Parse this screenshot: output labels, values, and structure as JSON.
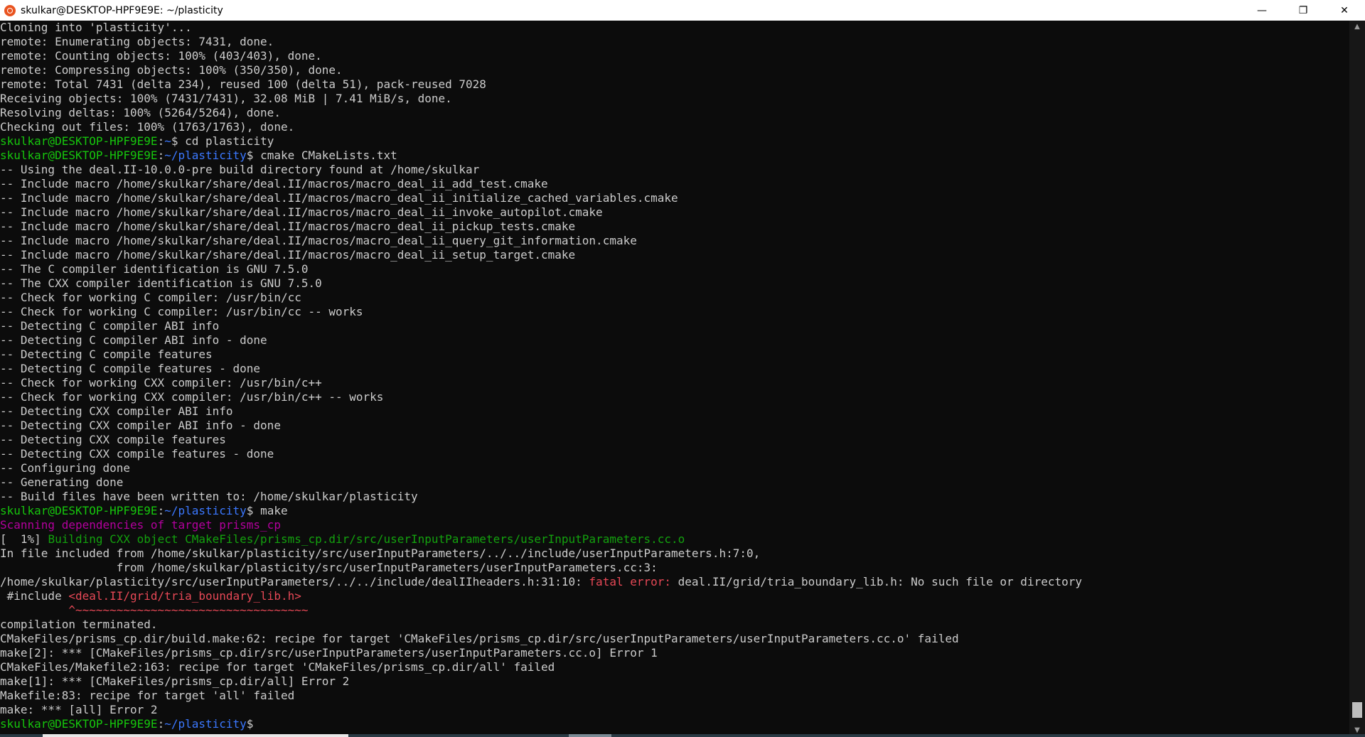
{
  "window": {
    "title": "skulkar@DESKTOP-HPF9E9E: ~/plasticity",
    "minimize_glyph": "—",
    "restore_glyph": "❐",
    "close_glyph": "✕",
    "icon": "ubuntu-icon"
  },
  "colors": {
    "background": "#0c0c0c",
    "text": "#cccccc",
    "prompt_user": "#16c60c",
    "prompt_path": "#3b78ff",
    "magenta": "#b4009e",
    "build_green": "#13a10e",
    "error_red": "#e74856"
  },
  "terminal": {
    "lines": [
      [
        {
          "t": "Cloning into 'plasticity'...",
          "c": "default"
        }
      ],
      [
        {
          "t": "remote: Enumerating objects: 7431, done.",
          "c": "default"
        }
      ],
      [
        {
          "t": "remote: Counting objects: 100% (403/403), done.",
          "c": "default"
        }
      ],
      [
        {
          "t": "remote: Compressing objects: 100% (350/350), done.",
          "c": "default"
        }
      ],
      [
        {
          "t": "remote: Total 7431 (delta 234), reused 100 (delta 51), pack-reused 7028",
          "c": "default"
        }
      ],
      [
        {
          "t": "Receiving objects: 100% (7431/7431), 32.08 MiB | 7.41 MiB/s, done.",
          "c": "default"
        }
      ],
      [
        {
          "t": "Resolving deltas: 100% (5264/5264), done.",
          "c": "default"
        }
      ],
      [
        {
          "t": "Checking out files: 100% (1763/1763), done.",
          "c": "default"
        }
      ],
      [
        {
          "t": "skulkar@DESKTOP-HPF9E9E",
          "c": "green"
        },
        {
          "t": ":",
          "c": "default"
        },
        {
          "t": "~",
          "c": "blue"
        },
        {
          "t": "$ cd plasticity",
          "c": "default"
        }
      ],
      [
        {
          "t": "skulkar@DESKTOP-HPF9E9E",
          "c": "green"
        },
        {
          "t": ":",
          "c": "default"
        },
        {
          "t": "~/plasticity",
          "c": "blue"
        },
        {
          "t": "$ cmake CMakeLists.txt",
          "c": "default"
        }
      ],
      [
        {
          "t": "-- Using the deal.II-10.0.0-pre build directory found at /home/skulkar",
          "c": "default"
        }
      ],
      [
        {
          "t": "-- Include macro /home/skulkar/share/deal.II/macros/macro_deal_ii_add_test.cmake",
          "c": "default"
        }
      ],
      [
        {
          "t": "-- Include macro /home/skulkar/share/deal.II/macros/macro_deal_ii_initialize_cached_variables.cmake",
          "c": "default"
        }
      ],
      [
        {
          "t": "-- Include macro /home/skulkar/share/deal.II/macros/macro_deal_ii_invoke_autopilot.cmake",
          "c": "default"
        }
      ],
      [
        {
          "t": "-- Include macro /home/skulkar/share/deal.II/macros/macro_deal_ii_pickup_tests.cmake",
          "c": "default"
        }
      ],
      [
        {
          "t": "-- Include macro /home/skulkar/share/deal.II/macros/macro_deal_ii_query_git_information.cmake",
          "c": "default"
        }
      ],
      [
        {
          "t": "-- Include macro /home/skulkar/share/deal.II/macros/macro_deal_ii_setup_target.cmake",
          "c": "default"
        }
      ],
      [
        {
          "t": "-- The C compiler identification is GNU 7.5.0",
          "c": "default"
        }
      ],
      [
        {
          "t": "-- The CXX compiler identification is GNU 7.5.0",
          "c": "default"
        }
      ],
      [
        {
          "t": "-- Check for working C compiler: /usr/bin/cc",
          "c": "default"
        }
      ],
      [
        {
          "t": "-- Check for working C compiler: /usr/bin/cc -- works",
          "c": "default"
        }
      ],
      [
        {
          "t": "-- Detecting C compiler ABI info",
          "c": "default"
        }
      ],
      [
        {
          "t": "-- Detecting C compiler ABI info - done",
          "c": "default"
        }
      ],
      [
        {
          "t": "-- Detecting C compile features",
          "c": "default"
        }
      ],
      [
        {
          "t": "-- Detecting C compile features - done",
          "c": "default"
        }
      ],
      [
        {
          "t": "-- Check for working CXX compiler: /usr/bin/c++",
          "c": "default"
        }
      ],
      [
        {
          "t": "-- Check for working CXX compiler: /usr/bin/c++ -- works",
          "c": "default"
        }
      ],
      [
        {
          "t": "-- Detecting CXX compiler ABI info",
          "c": "default"
        }
      ],
      [
        {
          "t": "-- Detecting CXX compiler ABI info - done",
          "c": "default"
        }
      ],
      [
        {
          "t": "-- Detecting CXX compile features",
          "c": "default"
        }
      ],
      [
        {
          "t": "-- Detecting CXX compile features - done",
          "c": "default"
        }
      ],
      [
        {
          "t": "-- Configuring done",
          "c": "default"
        }
      ],
      [
        {
          "t": "-- Generating done",
          "c": "default"
        }
      ],
      [
        {
          "t": "-- Build files have been written to: /home/skulkar/plasticity",
          "c": "default"
        }
      ],
      [
        {
          "t": "skulkar@DESKTOP-HPF9E9E",
          "c": "green"
        },
        {
          "t": ":",
          "c": "default"
        },
        {
          "t": "~/plasticity",
          "c": "blue"
        },
        {
          "t": "$ make",
          "c": "default"
        }
      ],
      [
        {
          "t": "Scanning dependencies of target prisms_cp",
          "c": "magenta"
        }
      ],
      [
        {
          "t": "[  1%] ",
          "c": "default"
        },
        {
          "t": "Building CXX object CMakeFiles/prisms_cp.dir/src/userInputParameters/userInputParameters.cc.o",
          "c": "dkgreen"
        }
      ],
      [
        {
          "t": "In file included from /home/skulkar/plasticity/src/userInputParameters/../../include/userInputParameters.h:7:0,",
          "c": "default"
        }
      ],
      [
        {
          "t": "                 from /home/skulkar/plasticity/src/userInputParameters/userInputParameters.cc:3:",
          "c": "default"
        }
      ],
      [
        {
          "t": "/home/skulkar/plasticity/src/userInputParameters/../../include/dealIIheaders.h:31:10: ",
          "c": "default"
        },
        {
          "t": "fatal error: ",
          "c": "red"
        },
        {
          "t": "deal.II/grid/tria_boundary_lib.h: No such file or directory",
          "c": "default"
        }
      ],
      [
        {
          "t": " #include ",
          "c": "default"
        },
        {
          "t": "<deal.II/grid/tria_boundary_lib.h>",
          "c": "red"
        }
      ],
      [
        {
          "t": "          ^~~~~~~~~~~~~~~~~~~~~~~~~~~~~~~~~~~",
          "c": "red"
        }
      ],
      [
        {
          "t": "compilation terminated.",
          "c": "default"
        }
      ],
      [
        {
          "t": "CMakeFiles/prisms_cp.dir/build.make:62: recipe for target 'CMakeFiles/prisms_cp.dir/src/userInputParameters/userInputParameters.cc.o' failed",
          "c": "default"
        }
      ],
      [
        {
          "t": "make[2]: *** [CMakeFiles/prisms_cp.dir/src/userInputParameters/userInputParameters.cc.o] Error 1",
          "c": "default"
        }
      ],
      [
        {
          "t": "CMakeFiles/Makefile2:163: recipe for target 'CMakeFiles/prisms_cp.dir/all' failed",
          "c": "default"
        }
      ],
      [
        {
          "t": "make[1]: *** [CMakeFiles/prisms_cp.dir/all] Error 2",
          "c": "default"
        }
      ],
      [
        {
          "t": "Makefile:83: recipe for target 'all' failed",
          "c": "default"
        }
      ],
      [
        {
          "t": "make: *** [all] Error 2",
          "c": "default"
        }
      ],
      [
        {
          "t": "skulkar@DESKTOP-HPF9E9E",
          "c": "green"
        },
        {
          "t": ":",
          "c": "default"
        },
        {
          "t": "~/plasticity",
          "c": "blue"
        },
        {
          "t": "$",
          "c": "default"
        }
      ]
    ]
  },
  "scrollbar": {
    "up_glyph": "▲",
    "down_glyph": "▼",
    "position": 0.99
  }
}
